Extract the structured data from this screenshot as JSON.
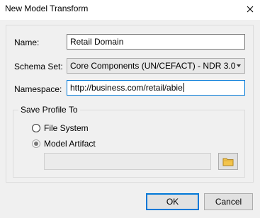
{
  "window": {
    "title": "New Model Transform",
    "close_icon": "close-icon"
  },
  "form": {
    "name": {
      "label": "Name:",
      "value": "Retail Domain"
    },
    "schema_set": {
      "label": "Schema Set:",
      "value": "Core Components (UN/CEFACT) - NDR 3.0",
      "icon": "chevron-down-icon"
    },
    "namespace": {
      "label": "Namespace:",
      "value": "http://business.com/retail/abie"
    }
  },
  "save_profile": {
    "label": "Save Profile To",
    "options": [
      {
        "label": "File System",
        "selected": false
      },
      {
        "label": "Model Artifact",
        "selected": true
      }
    ],
    "path": "",
    "browse_icon": "folder-icon"
  },
  "buttons": {
    "ok": "OK",
    "cancel": "Cancel"
  },
  "colors": {
    "accent": "#0078d7",
    "dialog_bg": "#f0f0f0"
  }
}
